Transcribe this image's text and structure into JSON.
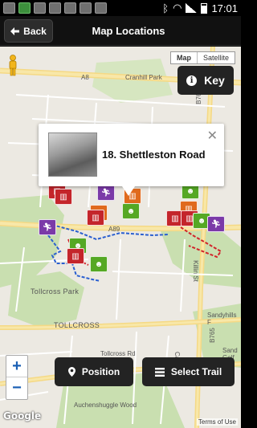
{
  "status_bar": {
    "time": "17:01"
  },
  "header": {
    "back_label": "Back",
    "title": "Map Locations"
  },
  "map_controls": {
    "map_type_options": [
      "Map",
      "Satellite"
    ],
    "key_label": "Key"
  },
  "info_window": {
    "title": "18. Shettleston Road"
  },
  "map_labels": {
    "road_a8": "A8",
    "cranhill_park": "Cranhill Park",
    "b765_top": "B765",
    "a89": "A89",
    "killin_st": "Killin St",
    "tollcross_park": "Tollcross Park",
    "tollcross": "TOLLCROSS",
    "tollcross_rd": "Tollcross Rd",
    "b765_lower": "B765",
    "sandyhills": "Sandyhills F",
    "sandy_golf": "Sand Golf",
    "auchenshuggle": "Auchenshuggle Wood",
    "car": "Car"
  },
  "bottom": {
    "position_label": "Position",
    "select_trail_label": "Select Trail",
    "zoom_in": "+",
    "zoom_out": "−",
    "google": "Google",
    "terms": "Terms of Use"
  },
  "colors": {
    "marker_red": "#c4252b",
    "marker_green": "#55a824",
    "marker_purple": "#7b3aa8",
    "marker_orange": "#e06a1d",
    "trail_blue": "#2a5fd0",
    "trail_red": "#d2232a"
  }
}
